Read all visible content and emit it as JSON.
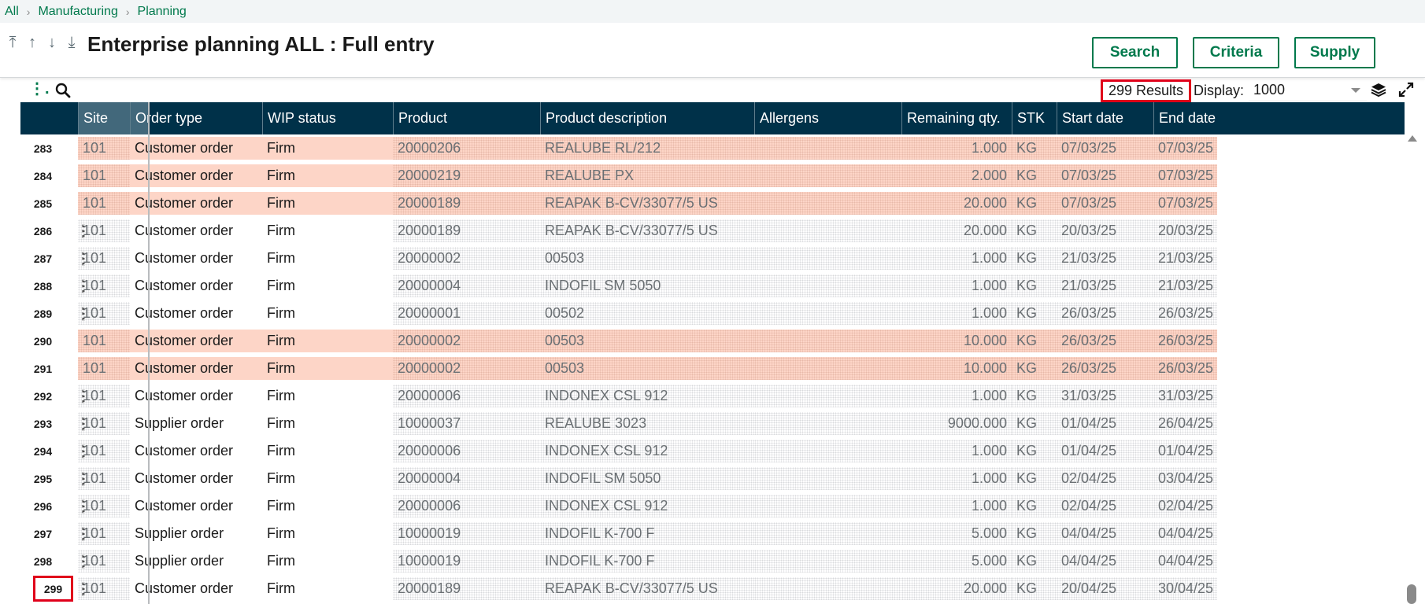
{
  "breadcrumb": [
    "All",
    "Manufacturing",
    "Planning"
  ],
  "title": "Enterprise planning ALL : Full entry",
  "buttons": {
    "search": "Search",
    "criteria": "Criteria",
    "supply": "Supply"
  },
  "toolbar": {
    "results": "299 Results",
    "display_label": "Display:",
    "display_value": "1000"
  },
  "columns": [
    "Site",
    "Order type",
    "WIP status",
    "Product",
    "Product description",
    "Allergens",
    "Remaining qty.",
    "STK",
    "Start date",
    "End date"
  ],
  "rows": [
    {
      "n": "283",
      "site": "101",
      "order_type": "Customer order",
      "wip": "Firm",
      "product": "20000206",
      "desc": "REALUBE RL/212",
      "allergens": "",
      "qty": "1.000",
      "stk": "KG",
      "start": "07/03/25",
      "end": "07/03/25",
      "highlight": true
    },
    {
      "n": "284",
      "site": "101",
      "order_type": "Customer order",
      "wip": "Firm",
      "product": "20000219",
      "desc": "REALUBE PX",
      "allergens": "",
      "qty": "2.000",
      "stk": "KG",
      "start": "07/03/25",
      "end": "07/03/25",
      "highlight": true
    },
    {
      "n": "285",
      "site": "101",
      "order_type": "Customer order",
      "wip": "Firm",
      "product": "20000189",
      "desc": "REAPAK B-CV/33077/5 US",
      "allergens": "",
      "qty": "20.000",
      "stk": "KG",
      "start": "07/03/25",
      "end": "07/03/25",
      "highlight": true
    },
    {
      "n": "286",
      "site": "101",
      "order_type": "Customer order",
      "wip": "Firm",
      "product": "20000189",
      "desc": "REAPAK B-CV/33077/5 US",
      "allergens": "",
      "qty": "20.000",
      "stk": "KG",
      "start": "20/03/25",
      "end": "20/03/25",
      "highlight": false
    },
    {
      "n": "287",
      "site": "101",
      "order_type": "Customer order",
      "wip": "Firm",
      "product": "20000002",
      "desc": "00503",
      "allergens": "",
      "qty": "1.000",
      "stk": "KG",
      "start": "21/03/25",
      "end": "21/03/25",
      "highlight": false
    },
    {
      "n": "288",
      "site": "101",
      "order_type": "Customer order",
      "wip": "Firm",
      "product": "20000004",
      "desc": "INDOFIL SM 5050",
      "allergens": "",
      "qty": "1.000",
      "stk": "KG",
      "start": "21/03/25",
      "end": "21/03/25",
      "highlight": false
    },
    {
      "n": "289",
      "site": "101",
      "order_type": "Customer order",
      "wip": "Firm",
      "product": "20000001",
      "desc": "00502",
      "allergens": "",
      "qty": "1.000",
      "stk": "KG",
      "start": "26/03/25",
      "end": "26/03/25",
      "highlight": false
    },
    {
      "n": "290",
      "site": "101",
      "order_type": "Customer order",
      "wip": "Firm",
      "product": "20000002",
      "desc": "00503",
      "allergens": "",
      "qty": "10.000",
      "stk": "KG",
      "start": "26/03/25",
      "end": "26/03/25",
      "highlight": true
    },
    {
      "n": "291",
      "site": "101",
      "order_type": "Customer order",
      "wip": "Firm",
      "product": "20000002",
      "desc": "00503",
      "allergens": "",
      "qty": "10.000",
      "stk": "KG",
      "start": "26/03/25",
      "end": "26/03/25",
      "highlight": true
    },
    {
      "n": "292",
      "site": "101",
      "order_type": "Customer order",
      "wip": "Firm",
      "product": "20000006",
      "desc": "INDONEX CSL 912",
      "allergens": "",
      "qty": "1.000",
      "stk": "KG",
      "start": "31/03/25",
      "end": "31/03/25",
      "highlight": false
    },
    {
      "n": "293",
      "site": "101",
      "order_type": "Supplier order",
      "wip": "Firm",
      "product": "10000037",
      "desc": "REALUBE 3023",
      "allergens": "",
      "qty": "9000.000",
      "stk": "KG",
      "start": "01/04/25",
      "end": "26/04/25",
      "highlight": false
    },
    {
      "n": "294",
      "site": "101",
      "order_type": "Customer order",
      "wip": "Firm",
      "product": "20000006",
      "desc": "INDONEX CSL 912",
      "allergens": "",
      "qty": "1.000",
      "stk": "KG",
      "start": "01/04/25",
      "end": "01/04/25",
      "highlight": false
    },
    {
      "n": "295",
      "site": "101",
      "order_type": "Customer order",
      "wip": "Firm",
      "product": "20000004",
      "desc": "INDOFIL SM 5050",
      "allergens": "",
      "qty": "1.000",
      "stk": "KG",
      "start": "02/04/25",
      "end": "03/04/25",
      "highlight": false
    },
    {
      "n": "296",
      "site": "101",
      "order_type": "Customer order",
      "wip": "Firm",
      "product": "20000006",
      "desc": "INDONEX CSL 912",
      "allergens": "",
      "qty": "1.000",
      "stk": "KG",
      "start": "02/04/25",
      "end": "02/04/25",
      "highlight": false
    },
    {
      "n": "297",
      "site": "101",
      "order_type": "Supplier order",
      "wip": "Firm",
      "product": "10000019",
      "desc": "INDOFIL K-700 F",
      "allergens": "",
      "qty": "5.000",
      "stk": "KG",
      "start": "04/04/25",
      "end": "04/04/25",
      "highlight": false
    },
    {
      "n": "298",
      "site": "101",
      "order_type": "Supplier order",
      "wip": "Firm",
      "product": "10000019",
      "desc": "INDOFIL K-700 F",
      "allergens": "",
      "qty": "5.000",
      "stk": "KG",
      "start": "04/04/25",
      "end": "04/04/25",
      "highlight": false
    },
    {
      "n": "299",
      "site": "101",
      "order_type": "Customer order",
      "wip": "Firm",
      "product": "20000189",
      "desc": "REAPAK B-CV/33077/5 US",
      "allergens": "",
      "qty": "20.000",
      "stk": "KG",
      "start": "20/04/25",
      "end": "30/04/25",
      "highlight": false,
      "marked": true
    }
  ],
  "colors": {
    "accent": "#00794c",
    "header_bg": "#003149",
    "row_highlight": "#fdd5c7",
    "marker": "#e0001a"
  },
  "icons": {
    "nav": [
      "first-record-icon",
      "previous-record-icon",
      "next-record-icon",
      "last-record-icon"
    ],
    "toolbar": [
      "more-actions-icon",
      "search-icon",
      "layers-icon",
      "expand-icon"
    ]
  }
}
